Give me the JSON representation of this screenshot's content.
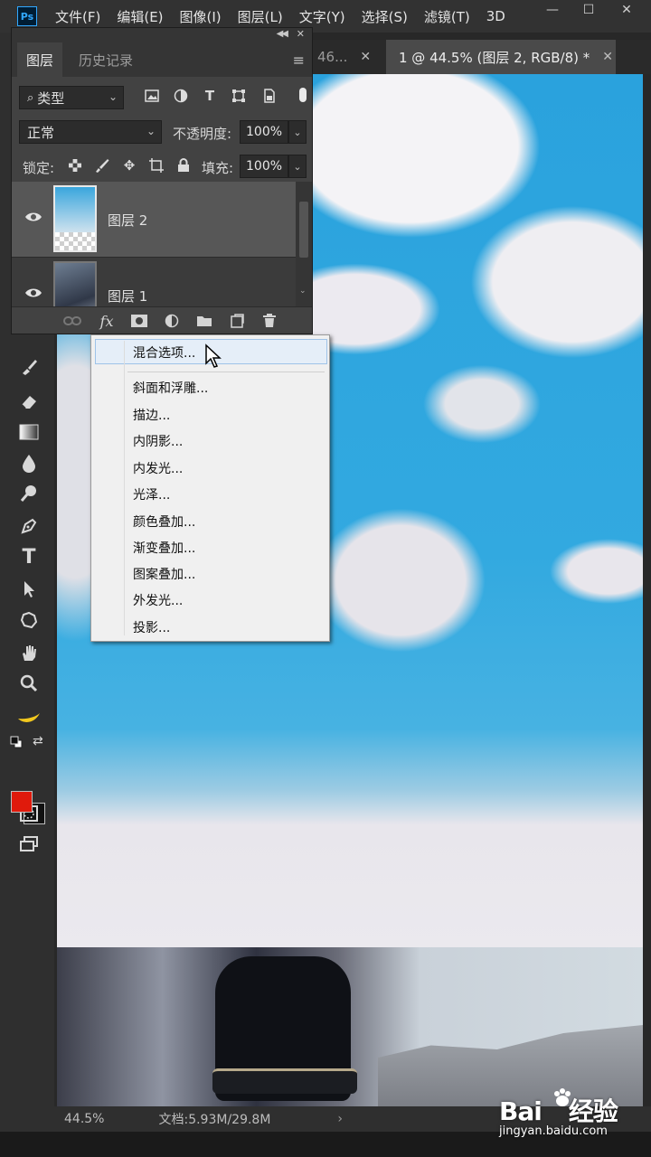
{
  "app": {
    "logo": "Ps"
  },
  "menubar": {
    "items": [
      "文件(F)",
      "编辑(E)",
      "图像(I)",
      "图层(L)",
      "文字(Y)",
      "选择(S)",
      "滤镜(T)",
      "3D"
    ],
    "window_controls": [
      "minimize-icon",
      "maximize-icon",
      "close-icon"
    ]
  },
  "document_tabs": [
    {
      "label": "46...",
      "active": false
    },
    {
      "label": "1 @ 44.5% (图层 2, RGB/8) *",
      "active": true
    }
  ],
  "layers_panel": {
    "tabs": [
      "图层",
      "历史记录"
    ],
    "filter": {
      "label": "类型",
      "icons": [
        "image-filter-icon",
        "adjustment-filter-icon",
        "type-filter-icon",
        "shape-filter-icon",
        "smart-object-filter-icon"
      ]
    },
    "blend_mode": "正常",
    "opacity_label": "不透明度:",
    "opacity_value": "100%",
    "lock_label": "锁定:",
    "fill_label": "填充:",
    "fill_value": "100%",
    "layers": [
      {
        "name": "图层 2",
        "selected": true,
        "visible": true
      },
      {
        "name": "图层 1",
        "selected": false,
        "visible": true
      }
    ],
    "footer_icons": [
      "link-layers-icon",
      "fx-icon",
      "add-mask-icon",
      "adjustment-layer-icon",
      "group-folder-icon",
      "new-layer-icon",
      "trash-icon"
    ],
    "fx_label": "fx"
  },
  "fx_menu": {
    "items": [
      "混合选项...",
      "斜面和浮雕...",
      "描边...",
      "内阴影...",
      "内发光...",
      "光泽...",
      "颜色叠加...",
      "渐变叠加...",
      "图案叠加...",
      "外发光...",
      "投影..."
    ],
    "hovered_index": 0
  },
  "toolbar": {
    "tools": [
      "brush-icon",
      "eraser-icon",
      "gradient-icon",
      "blur-drop-icon",
      "dodge-icon",
      "pen-icon",
      "type-tool-icon",
      "path-select-icon",
      "custom-shape-icon",
      "hand-icon",
      "zoom-icon",
      "banana-icon"
    ],
    "type_tool_glyph": "T",
    "foreground_color": "#e01a0c",
    "background_color": "#111111"
  },
  "statusbar": {
    "zoom": "44.5%",
    "doc_info": "文档:5.93M/29.8M"
  },
  "watermark": {
    "brand_left": "Bai",
    "brand_right": "经验",
    "url": "jingyan.baidu.com"
  }
}
